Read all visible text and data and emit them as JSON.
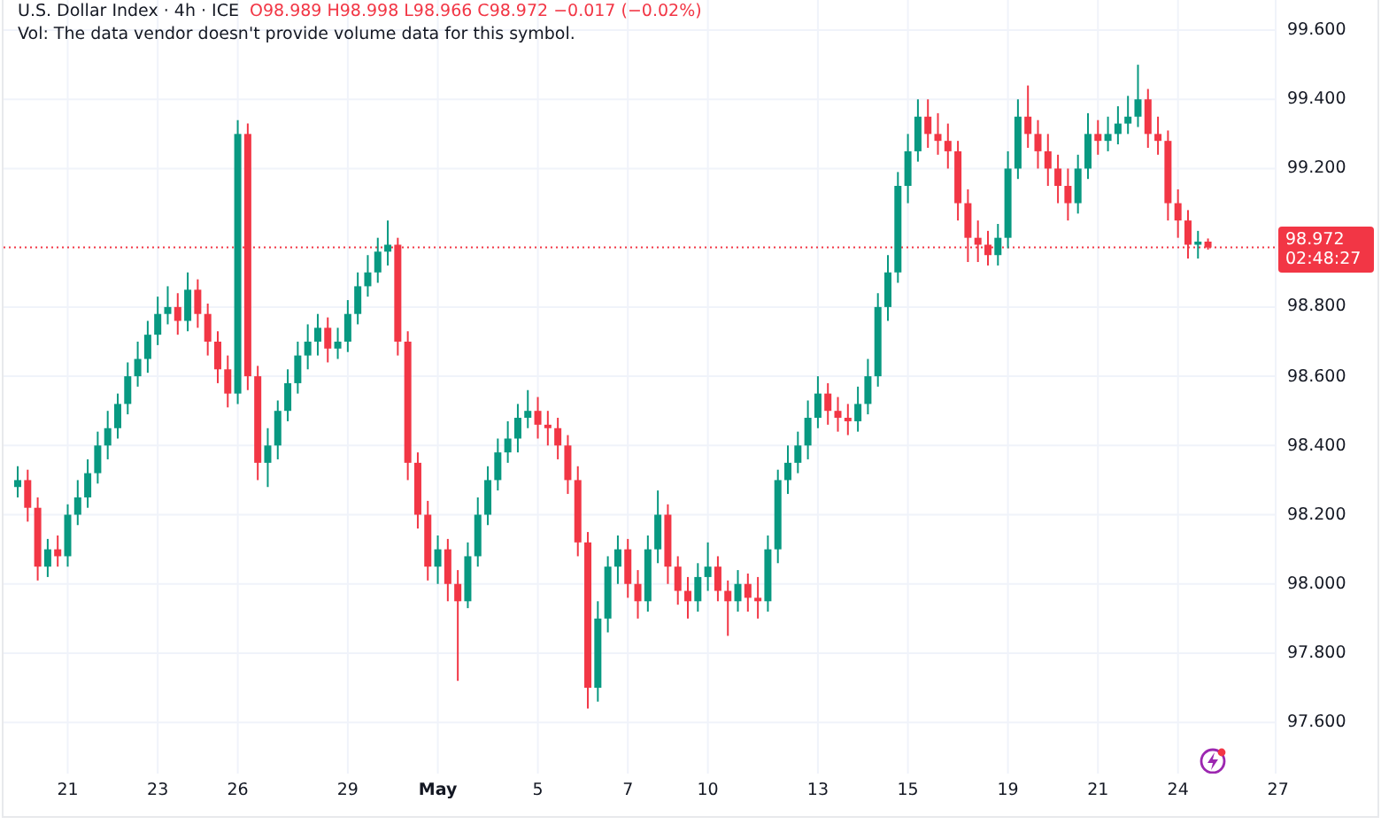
{
  "legend": {
    "title": "U.S. Dollar Index · 4h · ICE",
    "ohlc": "O98.989 H98.998 L98.966 C98.972 −0.017 (−0.02%)",
    "volume_note": "Vol: The data vendor doesn't provide volume data for this symbol."
  },
  "chart_data": {
    "type": "candlestick",
    "ylim": [
      97.447,
      99.687
    ],
    "grid": true,
    "ref_lines": [
      {
        "axis": "y",
        "value": 98.972
      }
    ],
    "categories": [
      null,
      null,
      null,
      null,
      null,
      "21",
      null,
      null,
      null,
      null,
      null,
      null,
      null,
      null,
      "23",
      null,
      null,
      null,
      null,
      null,
      null,
      null,
      "26",
      null,
      null,
      null,
      null,
      null,
      null,
      null,
      null,
      null,
      null,
      "29",
      null,
      null,
      null,
      null,
      null,
      null,
      null,
      null,
      "May",
      null,
      null,
      null,
      null,
      null,
      null,
      null,
      null,
      null,
      "5",
      null,
      null,
      null,
      null,
      null,
      null,
      null,
      null,
      "7",
      null,
      null,
      null,
      null,
      null,
      null,
      null,
      "10",
      null,
      null,
      null,
      null,
      null,
      null,
      null,
      null,
      null,
      null,
      "13",
      null,
      null,
      null,
      null,
      null,
      null,
      null,
      null,
      "15",
      null,
      null,
      null,
      null,
      null,
      null,
      null,
      null,
      null,
      "19",
      null,
      null,
      null,
      null,
      null,
      null,
      null,
      null,
      "21",
      null,
      null,
      null,
      null,
      null,
      null,
      null,
      "24",
      null,
      null,
      null,
      null,
      null,
      null,
      null,
      null,
      null,
      "27"
    ],
    "yticks": [
      {
        "value": 99.6,
        "label": "99.600"
      },
      {
        "value": 99.4,
        "label": "99.400"
      },
      {
        "value": 99.2,
        "label": "99.200"
      },
      {
        "value": 98.8,
        "label": "98.800"
      },
      {
        "value": 98.6,
        "label": "98.600"
      },
      {
        "value": 98.4,
        "label": "98.400"
      },
      {
        "value": 98.2,
        "label": "98.200"
      },
      {
        "value": 98.0,
        "label": "98.000"
      },
      {
        "value": 97.8,
        "label": "97.800"
      },
      {
        "value": 97.6,
        "label": "97.600"
      }
    ],
    "ohlc": [
      [
        98.28,
        98.34,
        98.25,
        98.3
      ],
      [
        98.3,
        98.33,
        98.18,
        98.22
      ],
      [
        98.22,
        98.25,
        98.01,
        98.05
      ],
      [
        98.05,
        98.13,
        98.02,
        98.1
      ],
      [
        98.1,
        98.14,
        98.05,
        98.08
      ],
      [
        98.08,
        98.23,
        98.05,
        98.2
      ],
      [
        98.2,
        98.3,
        98.17,
        98.25
      ],
      [
        98.25,
        98.36,
        98.22,
        98.32
      ],
      [
        98.32,
        98.44,
        98.29,
        98.4
      ],
      [
        98.4,
        98.5,
        98.36,
        98.45
      ],
      [
        98.45,
        98.55,
        98.42,
        98.52
      ],
      [
        98.52,
        98.64,
        98.49,
        98.6
      ],
      [
        98.6,
        98.7,
        98.57,
        98.65
      ],
      [
        98.65,
        98.76,
        98.61,
        98.72
      ],
      [
        98.72,
        98.83,
        98.69,
        98.78
      ],
      [
        98.78,
        98.86,
        98.75,
        98.8
      ],
      [
        98.8,
        98.84,
        98.72,
        98.76
      ],
      [
        98.76,
        98.9,
        98.73,
        98.85
      ],
      [
        98.85,
        98.88,
        98.74,
        98.78
      ],
      [
        98.78,
        98.81,
        98.66,
        98.7
      ],
      [
        98.7,
        98.73,
        98.58,
        98.62
      ],
      [
        98.62,
        98.66,
        98.51,
        98.55
      ],
      [
        98.55,
        99.34,
        98.52,
        99.3
      ],
      [
        99.3,
        99.33,
        98.56,
        98.6
      ],
      [
        98.6,
        98.63,
        98.3,
        98.35
      ],
      [
        98.35,
        98.45,
        98.28,
        98.4
      ],
      [
        98.4,
        98.53,
        98.36,
        98.5
      ],
      [
        98.5,
        98.62,
        98.47,
        98.58
      ],
      [
        98.58,
        98.7,
        98.55,
        98.66
      ],
      [
        98.66,
        98.75,
        98.62,
        98.7
      ],
      [
        98.7,
        98.78,
        98.66,
        98.74
      ],
      [
        98.74,
        98.77,
        98.64,
        98.68
      ],
      [
        98.68,
        98.74,
        98.65,
        98.7
      ],
      [
        98.7,
        98.82,
        98.67,
        98.78
      ],
      [
        98.78,
        98.9,
        98.75,
        98.86
      ],
      [
        98.86,
        98.95,
        98.83,
        98.9
      ],
      [
        98.9,
        99.0,
        98.87,
        98.96
      ],
      [
        98.96,
        99.05,
        98.92,
        98.98
      ],
      [
        98.98,
        99.0,
        98.66,
        98.7
      ],
      [
        98.7,
        98.73,
        98.3,
        98.35
      ],
      [
        98.35,
        98.38,
        98.16,
        98.2
      ],
      [
        98.2,
        98.24,
        98.01,
        98.05
      ],
      [
        98.05,
        98.14,
        98.0,
        98.1
      ],
      [
        98.1,
        98.13,
        97.95,
        98.0
      ],
      [
        98.0,
        98.04,
        97.72,
        97.95
      ],
      [
        97.95,
        98.12,
        97.93,
        98.08
      ],
      [
        98.08,
        98.25,
        98.05,
        98.2
      ],
      [
        98.2,
        98.34,
        98.17,
        98.3
      ],
      [
        98.3,
        98.42,
        98.27,
        98.38
      ],
      [
        98.38,
        98.47,
        98.35,
        98.42
      ],
      [
        98.42,
        98.52,
        98.38,
        98.48
      ],
      [
        98.48,
        98.56,
        98.45,
        98.5
      ],
      [
        98.5,
        98.54,
        98.42,
        98.46
      ],
      [
        98.46,
        98.5,
        98.4,
        98.45
      ],
      [
        98.45,
        98.48,
        98.36,
        98.4
      ],
      [
        98.4,
        98.43,
        98.26,
        98.3
      ],
      [
        98.3,
        98.34,
        98.08,
        98.12
      ],
      [
        98.12,
        98.15,
        97.64,
        97.7
      ],
      [
        97.7,
        97.95,
        97.66,
        97.9
      ],
      [
        97.9,
        98.08,
        97.86,
        98.05
      ],
      [
        98.05,
        98.14,
        98.0,
        98.1
      ],
      [
        98.1,
        98.13,
        97.96,
        98.0
      ],
      [
        98.0,
        98.04,
        97.9,
        97.95
      ],
      [
        97.95,
        98.14,
        97.92,
        98.1
      ],
      [
        98.1,
        98.27,
        98.06,
        98.2
      ],
      [
        98.2,
        98.23,
        98.0,
        98.05
      ],
      [
        98.05,
        98.08,
        97.94,
        97.98
      ],
      [
        97.98,
        98.02,
        97.9,
        97.95
      ],
      [
        97.95,
        98.06,
        97.92,
        98.02
      ],
      [
        98.02,
        98.12,
        97.98,
        98.05
      ],
      [
        98.05,
        98.08,
        97.95,
        97.98
      ],
      [
        97.98,
        98.01,
        97.85,
        97.95
      ],
      [
        97.95,
        98.04,
        97.92,
        98.0
      ],
      [
        98.0,
        98.03,
        97.92,
        97.96
      ],
      [
        97.96,
        98.02,
        97.9,
        97.95
      ],
      [
        97.95,
        98.14,
        97.92,
        98.1
      ],
      [
        98.1,
        98.33,
        98.06,
        98.3
      ],
      [
        98.3,
        98.4,
        98.26,
        98.35
      ],
      [
        98.35,
        98.44,
        98.32,
        98.4
      ],
      [
        98.4,
        98.53,
        98.36,
        98.48
      ],
      [
        98.48,
        98.6,
        98.45,
        98.55
      ],
      [
        98.55,
        98.58,
        98.46,
        98.5
      ],
      [
        98.5,
        98.54,
        98.44,
        98.48
      ],
      [
        98.48,
        98.52,
        98.43,
        98.47
      ],
      [
        98.47,
        98.57,
        98.44,
        98.52
      ],
      [
        98.52,
        98.65,
        98.49,
        98.6
      ],
      [
        98.6,
        98.84,
        98.57,
        98.8
      ],
      [
        98.8,
        98.95,
        98.76,
        98.9
      ],
      [
        98.9,
        99.19,
        98.87,
        99.15
      ],
      [
        99.15,
        99.3,
        99.1,
        99.25
      ],
      [
        99.25,
        99.4,
        99.22,
        99.35
      ],
      [
        99.35,
        99.4,
        99.26,
        99.3
      ],
      [
        99.3,
        99.36,
        99.24,
        99.28
      ],
      [
        99.28,
        99.33,
        99.2,
        99.25
      ],
      [
        99.25,
        99.28,
        99.05,
        99.1
      ],
      [
        99.1,
        99.14,
        98.93,
        99.0
      ],
      [
        99.0,
        99.05,
        98.93,
        98.98
      ],
      [
        98.98,
        99.02,
        98.92,
        98.95
      ],
      [
        98.95,
        99.04,
        98.92,
        99.0
      ],
      [
        99.0,
        99.25,
        98.97,
        99.2
      ],
      [
        99.2,
        99.4,
        99.17,
        99.35
      ],
      [
        99.35,
        99.44,
        99.26,
        99.3
      ],
      [
        99.3,
        99.34,
        99.2,
        99.25
      ],
      [
        99.25,
        99.3,
        99.15,
        99.2
      ],
      [
        99.2,
        99.24,
        99.1,
        99.15
      ],
      [
        99.15,
        99.2,
        99.05,
        99.1
      ],
      [
        99.1,
        99.24,
        99.07,
        99.2
      ],
      [
        99.2,
        99.36,
        99.17,
        99.3
      ],
      [
        99.3,
        99.34,
        99.24,
        99.28
      ],
      [
        99.28,
        99.35,
        99.25,
        99.3
      ],
      [
        99.3,
        99.38,
        99.27,
        99.33
      ],
      [
        99.33,
        99.41,
        99.3,
        99.35
      ],
      [
        99.35,
        99.5,
        99.32,
        99.4
      ],
      [
        99.4,
        99.43,
        99.26,
        99.3
      ],
      [
        99.3,
        99.35,
        99.24,
        99.28
      ],
      [
        99.28,
        99.31,
        99.05,
        99.1
      ],
      [
        99.1,
        99.14,
        99.0,
        99.05
      ],
      [
        99.05,
        99.08,
        98.94,
        98.98
      ],
      [
        98.98,
        99.02,
        98.94,
        98.989
      ],
      [
        98.989,
        98.998,
        98.966,
        98.972
      ],
      null,
      null,
      null,
      null,
      null,
      null,
      null
    ]
  },
  "price_tag": {
    "price": "98.972",
    "countdown": "02:48:27"
  },
  "time_axis": {
    "label_styles": [
      {
        "bold": false
      },
      {
        "bold": false
      },
      {
        "bold": false
      },
      {
        "bold": false
      },
      {
        "bold": true
      },
      {
        "bold": false
      },
      {
        "bold": false
      },
      {
        "bold": false
      },
      {
        "bold": false
      },
      {
        "bold": false
      },
      {
        "bold": false
      },
      {
        "bold": false
      },
      {
        "bold": false
      },
      {
        "bold": false
      }
    ]
  }
}
